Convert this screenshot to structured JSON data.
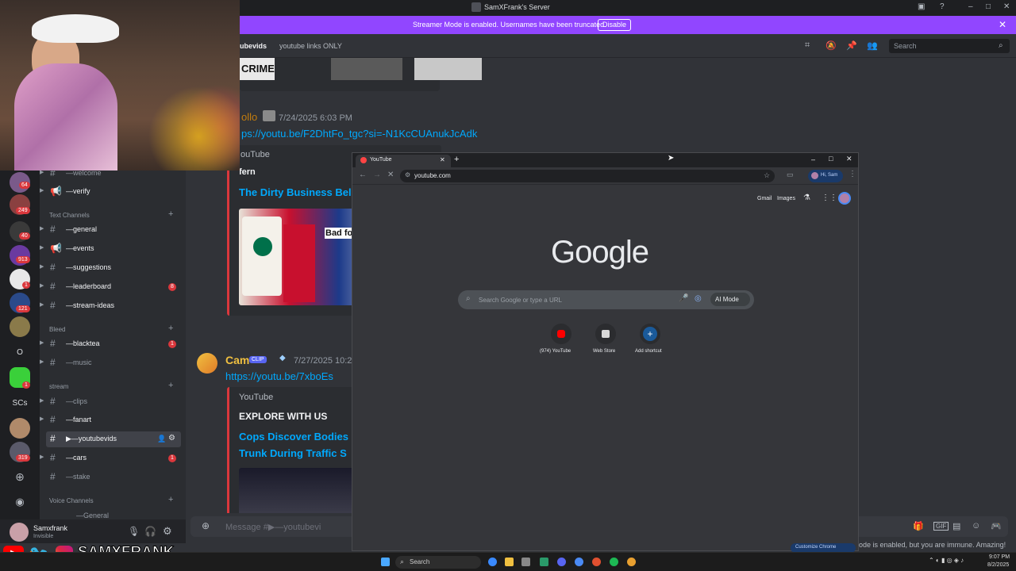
{
  "window": {
    "title": "SamXFrank's Server"
  },
  "banner": {
    "message": "Streamer Mode is enabled. Usernames have been truncated.",
    "disable_label": "Disable"
  },
  "channel_header": {
    "name": "ubevids",
    "topic": "youtube links ONLY",
    "search_placeholder": "Search"
  },
  "servers": [
    {
      "badge": "64"
    },
    {
      "badge": "249"
    },
    {
      "badge": "40"
    },
    {
      "badge": "913"
    },
    {
      "badge": "1"
    },
    {
      "badge": "121"
    },
    {
      "badge": ""
    },
    {
      "label": "O"
    },
    {
      "badge": "1"
    },
    {
      "label": "SCs"
    },
    {
      "badge": ""
    },
    {
      "badge": "319"
    }
  ],
  "channels": {
    "top": [
      {
        "name": "—welcome",
        "emoji": "👋"
      },
      {
        "name": "—verify",
        "emoji": "✅"
      }
    ],
    "cat_text": "Text Channels",
    "text": [
      {
        "name": "—general",
        "emoji": "🌍"
      },
      {
        "name": "—events",
        "emoji": "🎉"
      },
      {
        "name": "—suggestions",
        "emoji": "💭"
      },
      {
        "name": "—leaderboard",
        "emoji": "🏆",
        "badge": "8"
      },
      {
        "name": "—stream-ideas",
        "emoji": "💡"
      }
    ],
    "cat_bleed": "Bleed",
    "bleed": [
      {
        "name": "—blacktea",
        "emoji": "☕",
        "badge": "1"
      },
      {
        "name": "—music",
        "emoji": "🎵"
      }
    ],
    "cat_stream": "stream",
    "stream": [
      {
        "name": "—clips",
        "emoji": "🎬"
      },
      {
        "name": "—fanart",
        "emoji": "🎨"
      },
      {
        "name": "▶—youtubevids",
        "emoji": "",
        "selected": true
      },
      {
        "name": "—cars",
        "emoji": "🏎",
        "badge": "1"
      },
      {
        "name": "—stake",
        "emoji": "🎰"
      }
    ],
    "cat_voice": "Voice Channels",
    "voice": [
      {
        "name": "—General"
      }
    ]
  },
  "user": {
    "name": "Samxfrank",
    "status": "Invisible"
  },
  "messages": [
    {
      "author": "ollo",
      "time": "7/24/2025 6:03 PM",
      "link": "ps://youtu.be/F2DhtFo_tgc?si=-N1KcCUAnukJcAdk",
      "provider": "ouTube",
      "channel": "fern",
      "video_title": "The Dirty Business Bel",
      "thumb_text": "Bad fo"
    },
    {
      "author": "Cam",
      "tag": "CLIP",
      "time": "7/27/2025 10:2",
      "link": "https://youtu.be/7xboEs",
      "provider": "YouTube",
      "channel": "EXPLORE WITH US",
      "video_title_1": "Cops Discover Bodies",
      "video_title_2": "Trunk During Traffic S"
    }
  ],
  "thumb_top": {
    "text": "CRIME"
  },
  "composer": {
    "placeholder": "Message #▶—youtubevi"
  },
  "footer_notice": "ode is enabled, but you are immune. Amazing!",
  "chrome": {
    "tab_title": "YouTube",
    "url": "youtube.com",
    "profile": "Hi, Sam",
    "top_links": [
      "Gmail",
      "Images"
    ],
    "logo": "Google",
    "search_placeholder": "Search Google or type a URL",
    "ai_mode": "AI Mode",
    "shortcuts": [
      {
        "label": "(974) YouTube"
      },
      {
        "label": "Web Store"
      },
      {
        "label": "Add shortcut"
      }
    ],
    "customize": "Customize Chrome"
  },
  "overlay": {
    "handle": "SAMXFRANK"
  },
  "taskbar": {
    "search": "Search",
    "time": "9:07 PM",
    "date": "8/2/2025"
  },
  "colors": {
    "accent": "#9146ff",
    "link": "#00a8fc",
    "badge": "#da373c"
  }
}
